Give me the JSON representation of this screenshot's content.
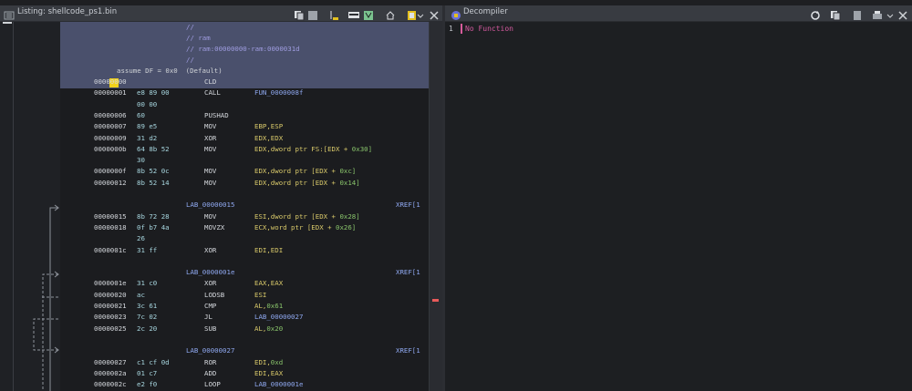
{
  "listing": {
    "title": "Listing:  shellcode_ps1.bin",
    "header": [
      "//",
      "// ram",
      "// ram:00000000-ram:0000031d",
      "//"
    ],
    "assume": "assume DF = 0x0  (Default)",
    "rows": [
      {
        "addr": "00000000",
        "bytes": "",
        "mn": "CLD",
        "op": "",
        "num": ""
      },
      {
        "addr": "00000001",
        "bytes": "e8 89 00",
        "mn": "CALL",
        "op": "FUN_0000008f",
        "num": ""
      },
      {
        "addr": "",
        "bytes": "00 00",
        "mn": "",
        "op": "",
        "num": ""
      },
      {
        "addr": "00000006",
        "bytes": "60",
        "mn": "PUSHAD",
        "op": "",
        "num": ""
      },
      {
        "addr": "00000007",
        "bytes": "89 e5",
        "mn": "MOV",
        "op": "EBP,ESP",
        "num": ""
      },
      {
        "addr": "00000009",
        "bytes": "31 d2",
        "mn": "XOR",
        "op": "EDX,EDX",
        "num": ""
      },
      {
        "addr": "0000000b",
        "bytes": "64 8b 52",
        "mn": "MOV",
        "op": "EDX,dword ptr FS:[EDX + ",
        "num": "0x30]"
      },
      {
        "addr": "",
        "bytes": "30",
        "mn": "",
        "op": "",
        "num": ""
      },
      {
        "addr": "0000000f",
        "bytes": "8b 52 0c",
        "mn": "MOV",
        "op": "EDX,dword ptr [EDX + ",
        "num": "0xc]"
      },
      {
        "addr": "00000012",
        "bytes": "8b 52 14",
        "mn": "MOV",
        "op": "EDX,dword ptr [EDX + ",
        "num": "0x14]"
      }
    ],
    "label1": "LAB_00000015",
    "rows2": [
      {
        "addr": "00000015",
        "bytes": "8b 72 28",
        "mn": "MOV",
        "op": "ESI,dword ptr [EDX + ",
        "num": "0x28]"
      },
      {
        "addr": "00000018",
        "bytes": "0f b7 4a",
        "mn": "MOVZX",
        "op": "ECX,word ptr [EDX + ",
        "num": "0x26]"
      },
      {
        "addr": "",
        "bytes": "26",
        "mn": "",
        "op": "",
        "num": ""
      },
      {
        "addr": "0000001c",
        "bytes": "31 ff",
        "mn": "XOR",
        "op": "EDI,EDI",
        "num": ""
      }
    ],
    "label2": "LAB_0000001e",
    "rows3": [
      {
        "addr": "0000001e",
        "bytes": "31 c0",
        "mn": "XOR",
        "op": "EAX,EAX",
        "num": ""
      },
      {
        "addr": "00000020",
        "bytes": "ac",
        "mn": "LODSB",
        "op": "ESI",
        "num": ""
      },
      {
        "addr": "00000021",
        "bytes": "3c 61",
        "mn": "CMP",
        "op": "AL,",
        "num": "0x61"
      },
      {
        "addr": "00000023",
        "bytes": "7c 02",
        "mn": "JL",
        "op": "LAB_00000027",
        "num": ""
      },
      {
        "addr": "00000025",
        "bytes": "2c 20",
        "mn": "SUB",
        "op": "AL,",
        "num": "0x20"
      }
    ],
    "label3": "LAB_00000027",
    "rows4": [
      {
        "addr": "00000027",
        "bytes": "c1 cf 0d",
        "mn": "ROR",
        "op": "EDI,",
        "num": "0xd"
      },
      {
        "addr": "0000002a",
        "bytes": "01 c7",
        "mn": "ADD",
        "op": "EDI,EAX",
        "num": ""
      },
      {
        "addr": "0000002c",
        "bytes": "e2 f0",
        "mn": "LOOP",
        "op": "LAB_0000001e",
        "num": ""
      }
    ],
    "xref": "XREF[1"
  },
  "decompiler": {
    "title": "Decompiler",
    "line_number": "1",
    "text": "No Function"
  },
  "colors": {
    "comment": "#9f9ce0",
    "operand": "#d9c96a",
    "number": "#89c46b",
    "label": "#8fa8f0",
    "decomp_text": "#d65aa0",
    "cursor": "#f2d21a"
  }
}
